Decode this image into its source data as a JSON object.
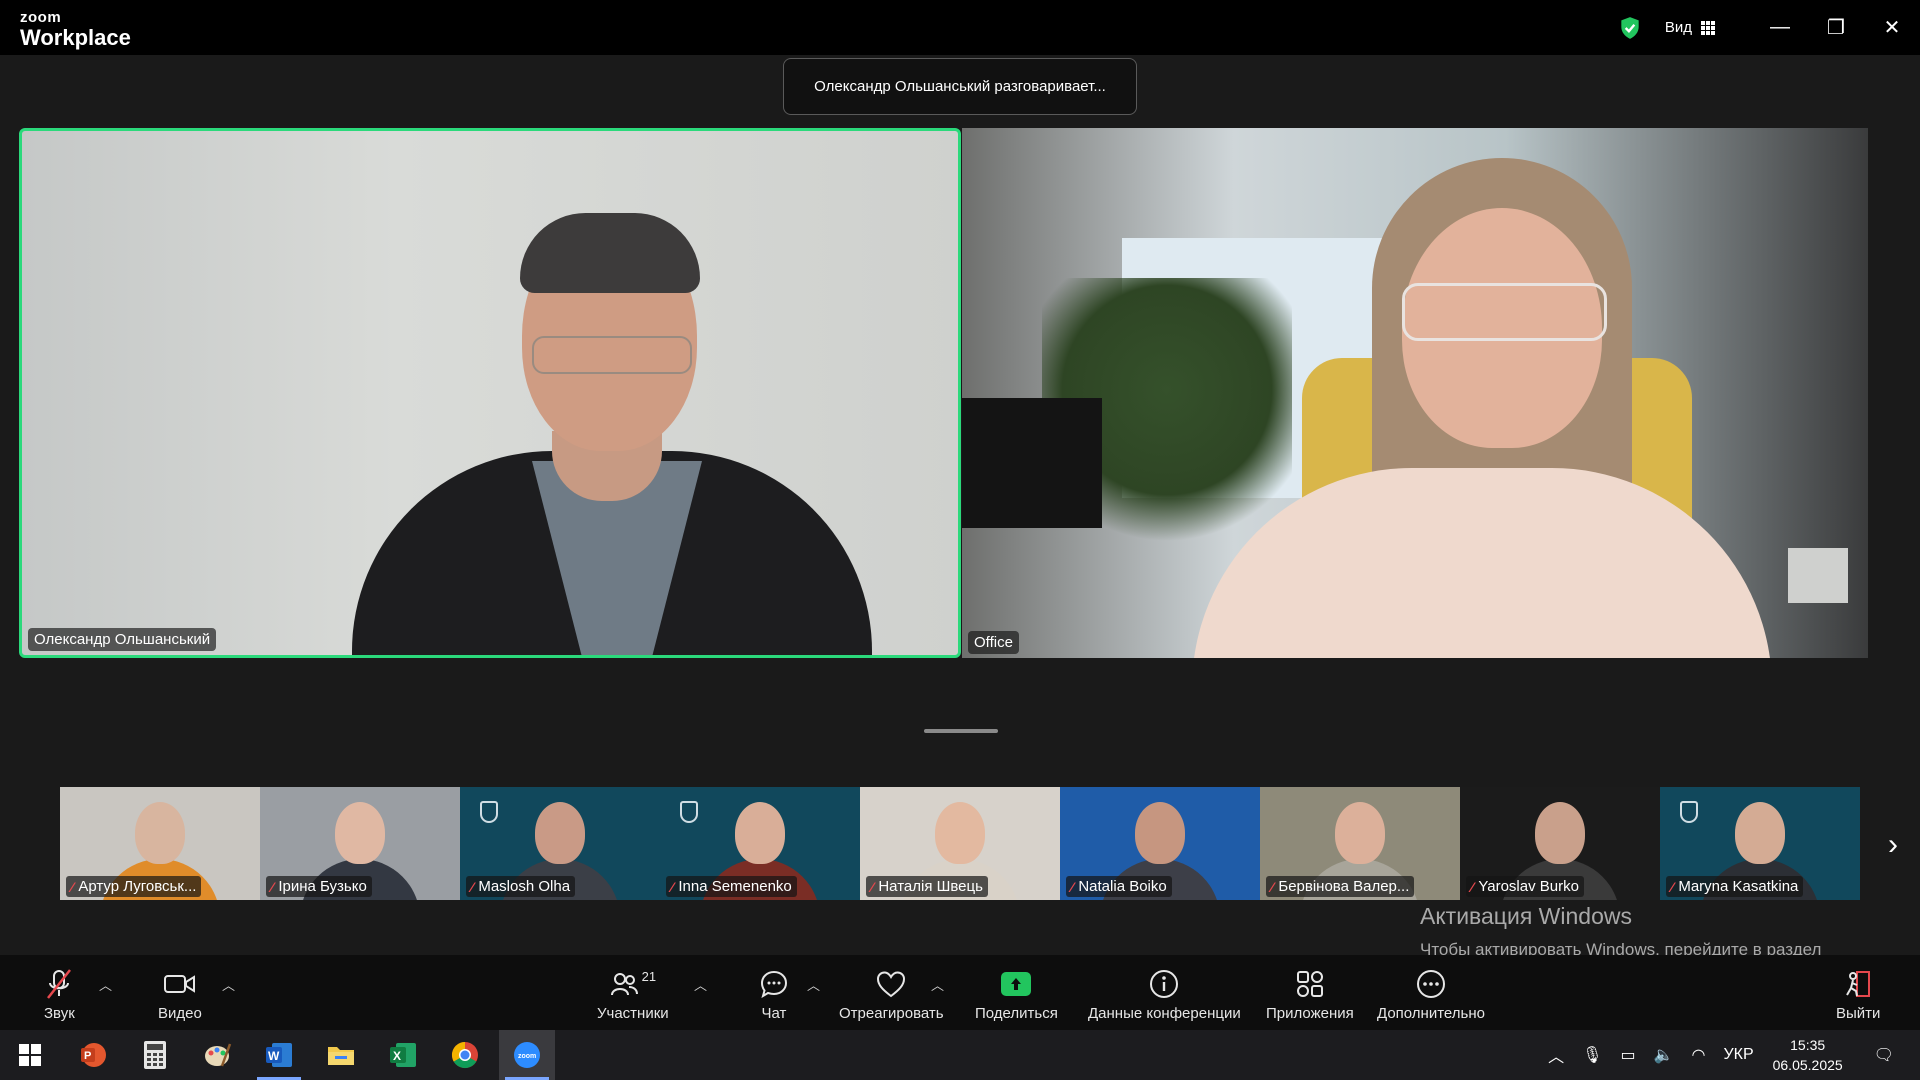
{
  "app": {
    "logo_small": "zoom",
    "logo_big": "Workplace"
  },
  "titlebar": {
    "view_label": "Вид",
    "minimize": "—",
    "restore": "❐",
    "close": "✕"
  },
  "speaking_banner": "Олександр Ольшанський разговаривает...",
  "main_videos": [
    {
      "name": "Олександр Ольшанський"
    },
    {
      "name": "Office"
    }
  ],
  "gallery": [
    {
      "name": "Артур Луговськ...",
      "bg": "#c9c6c1"
    },
    {
      "name": "Ірина Бузько",
      "bg": "#9a9ea3"
    },
    {
      "name": "Maslosh Olha",
      "bg": "#11485c"
    },
    {
      "name": "Inna Semenenko",
      "bg": "#11485c"
    },
    {
      "name": "Наталія Швець",
      "bg": "#d7d2cb"
    },
    {
      "name": "Natalia Boiko",
      "bg": "#1f5ca8"
    },
    {
      "name": "Бервінова Валер...",
      "bg": "#8e8a79"
    },
    {
      "name": "Yaroslav Burko",
      "bg": "#1b1b1b"
    },
    {
      "name": "Maryna Kasatkina",
      "bg": "#11485c"
    }
  ],
  "activation": {
    "title": "Активация Windows",
    "body": "Чтобы активировать Windows, перейдите в раздел \"Параметры\"."
  },
  "toolbar": {
    "audio": "Звук",
    "video": "Видео",
    "participants": "Участники",
    "participants_count": "21",
    "chat": "Чат",
    "react": "Отреагировать",
    "share": "Поделиться",
    "meeting_info": "Данные конференции",
    "apps": "Приложения",
    "more": "Дополнительно",
    "leave": "Выйти"
  },
  "taskbar": {
    "language": "УКР",
    "time": "15:35",
    "date": "06.05.2025"
  }
}
